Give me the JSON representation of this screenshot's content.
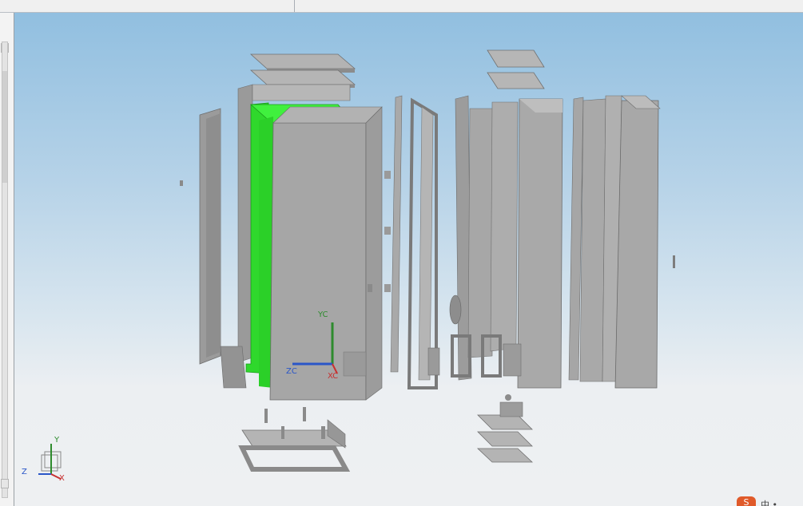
{
  "app": {
    "title": ""
  },
  "viewport": {
    "csys_labels": {
      "y": "YC",
      "z": "ZC",
      "x": "XC"
    },
    "triad_labels": {
      "y": "Y",
      "z": "Z",
      "x": "X"
    }
  },
  "colors": {
    "part": "#a3a3a3",
    "part_dark": "#8a8a8a",
    "part_light": "#c6c6c6",
    "highlight": "#3cf03a",
    "highlight_dark": "#27c826",
    "csys_y": "#2e8b2e",
    "csys_z": "#2a56c8",
    "csys_x": "#c83030",
    "status": "#e05a2a"
  },
  "icons": [
    "wcs-axis-icon",
    "view-triad-icon",
    "status-bar-icon"
  ],
  "status": {
    "icon_glyph": "S",
    "text": "中 •"
  }
}
